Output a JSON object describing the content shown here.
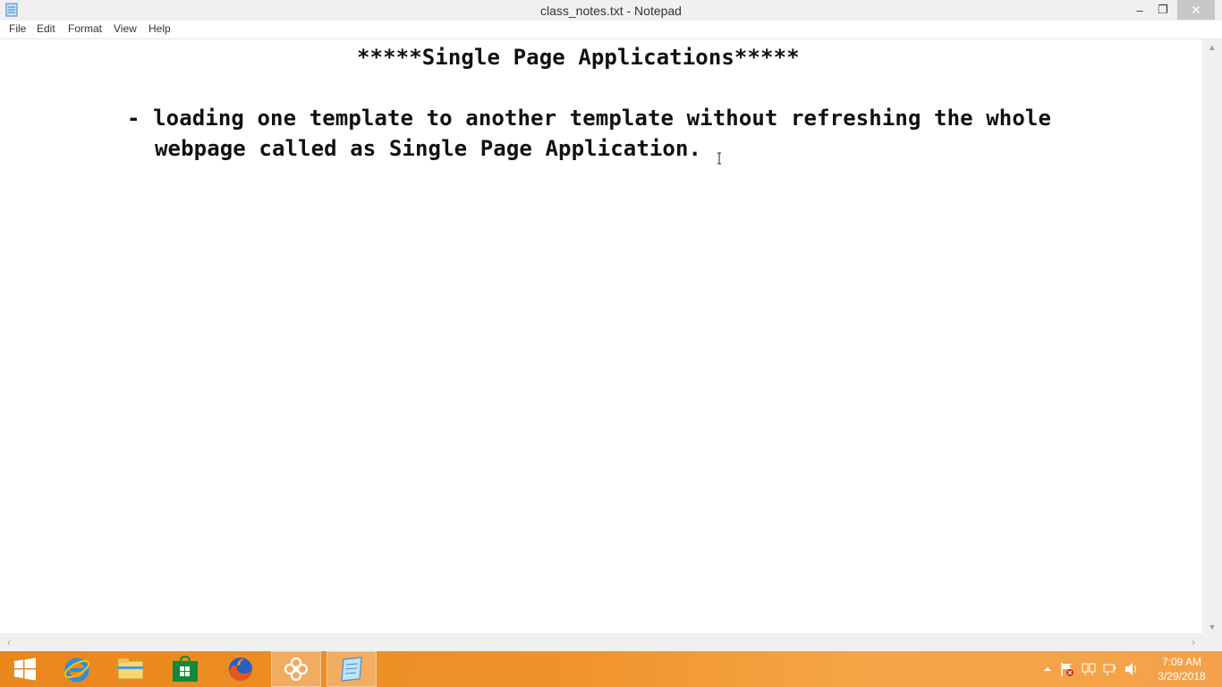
{
  "window": {
    "title": "class_notes.txt - Notepad",
    "min_glyph": "–",
    "max_glyph": "❐",
    "close_glyph": "✕"
  },
  "menu": [
    "File",
    "Edit",
    "Format",
    "View",
    "Help"
  ],
  "document": {
    "lines": [
      "*****Single Page Applications*****",
      "- loading one template to another template without refreshing the whole",
      "webpage called as Single Page Application."
    ]
  },
  "taskbar": {
    "apps": [
      "start-icon",
      "internet-explorer-icon",
      "file-explorer-icon",
      "store-icon",
      "firefox-icon",
      "flower-app-icon",
      "notepad-icon"
    ],
    "tray_icons": [
      "show-hidden-icons-arrow",
      "action-center-flag-icon",
      "network-icon",
      "power-icon",
      "volume-icon"
    ],
    "clock_time": "7:09 AM",
    "clock_date": "3/29/2018",
    "accent": "#f0922a"
  }
}
